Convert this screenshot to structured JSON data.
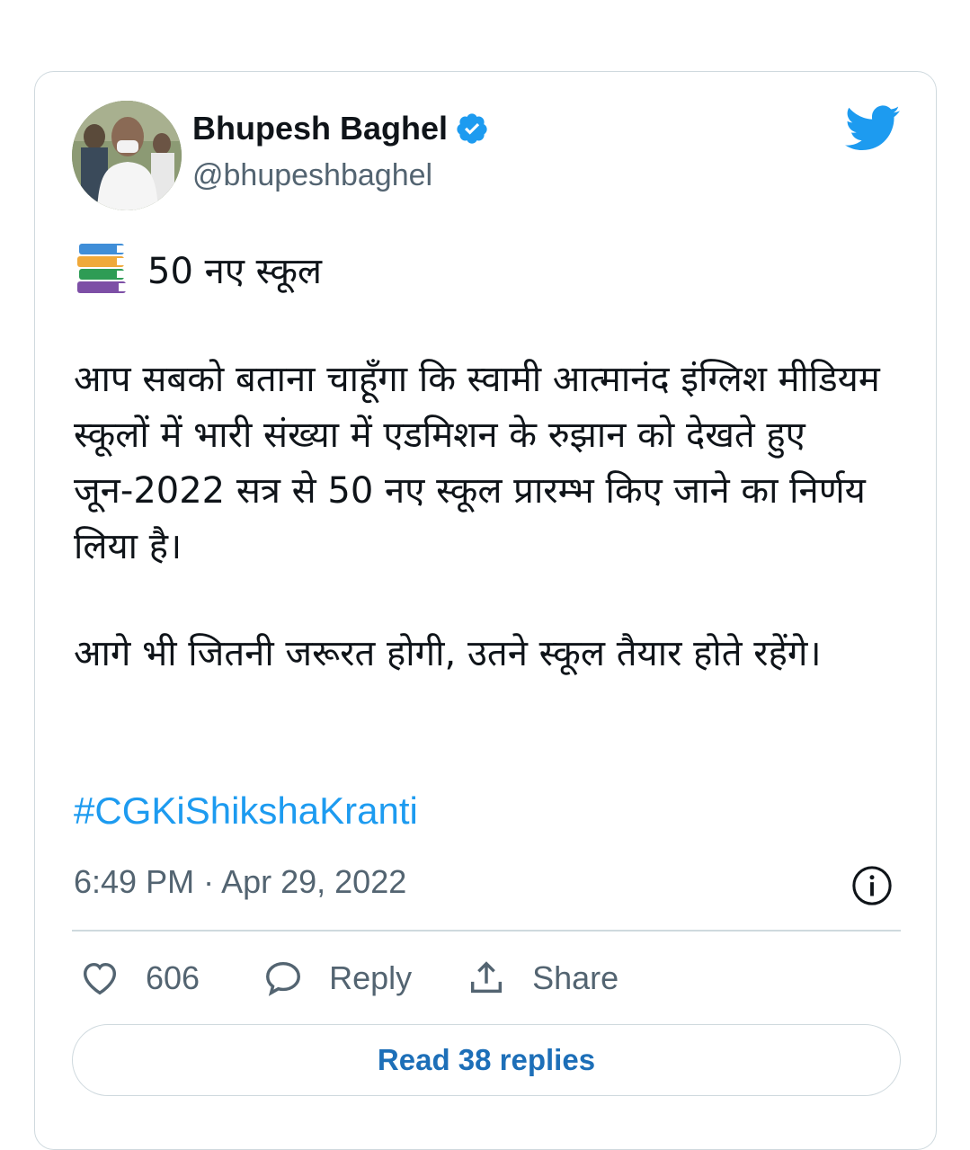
{
  "author": {
    "name": "Bhupesh Baghel",
    "handle": "@bhupeshbaghel"
  },
  "tweet": {
    "headline": "50 नए स्कूल",
    "paragraph_1": "आप सबको बताना चाहूँगा कि स्वामी आत्मानंद इंग्लिश मीडियम स्कूलों में भारी संख्या में एडमिशन के रुझान को देखते हुए जून-2022 सत्र से 50 नए स्कूल प्रारम्भ किए जाने का निर्णय लिया है।",
    "paragraph_2": "आगे भी जितनी जरूरत होगी, उतने स्कूल तैयार होते रहेंगे।",
    "hashtag": "#CGKiShikshaKranti",
    "timestamp": "6:49 PM · Apr 29, 2022"
  },
  "actions": {
    "like_count": "606",
    "reply_label": "Reply",
    "share_label": "Share"
  },
  "read_replies_label": "Read 38 replies",
  "icons": {
    "brand": "twitter-bird-icon",
    "verified": "verified-badge-icon",
    "headline_emoji": "books-icon",
    "info": "info-icon",
    "like": "heart-icon",
    "reply": "speech-bubble-icon",
    "share": "share-upload-icon"
  },
  "colors": {
    "accent": "#1d9bf0",
    "link_button": "#1d6fb8",
    "muted": "#536471",
    "border": "#cfd9de"
  }
}
